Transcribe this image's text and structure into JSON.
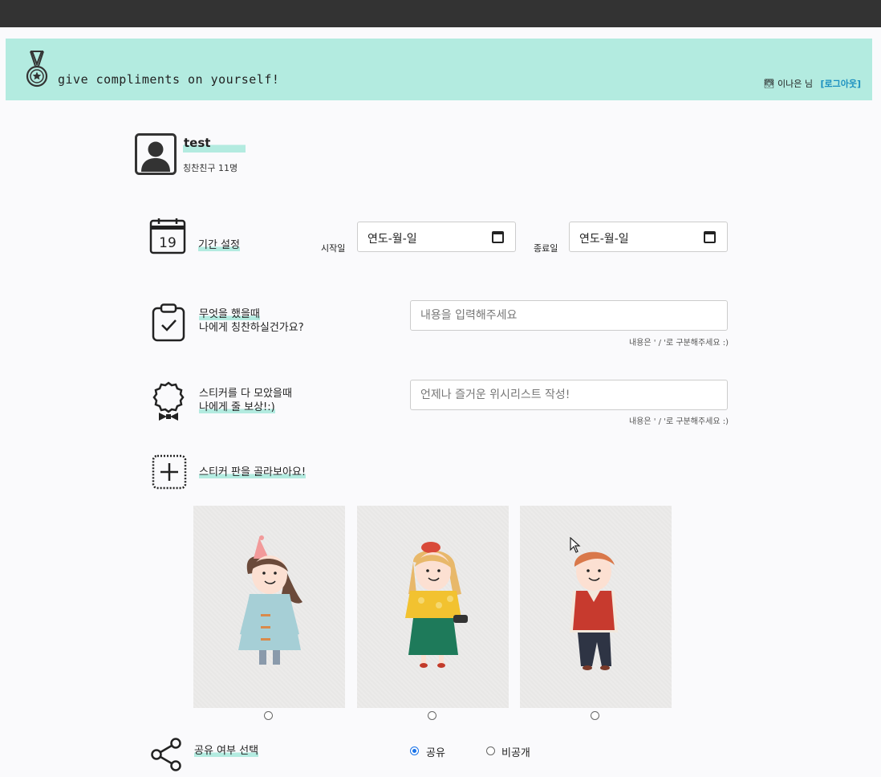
{
  "header": {
    "title": "give compliments on yourself!",
    "user_name": "이나은 님",
    "logout_label": "[로그아웃]",
    "user_icon": "sun-icon"
  },
  "profile": {
    "name": "test",
    "friends": "칭찬친구 11명"
  },
  "period": {
    "label": "기간 설정",
    "start_label": "시작일",
    "start_value": "연도-월-일",
    "end_label": "종료일",
    "end_value": "연도-월-일",
    "calendar_day": "19"
  },
  "task": {
    "line1": "무엇을 했을때",
    "line2": "나에게 칭찬하실건가요?",
    "placeholder": "내용을 입력해주세요",
    "hint": "내용은 ' / '로 구분해주세요 :)"
  },
  "reward": {
    "line1": "스티커를 다 모았을때",
    "line2": "나에게 줄 보상!:)",
    "placeholder": "언제나 즐거운 위시리스트 작성!",
    "hint": "내용은 ' / '로 구분해주세요 :)"
  },
  "sticker_board": {
    "label": "스티커 판을 골라보아요!",
    "options": [
      {
        "name": "girl-blue-coat",
        "selected": false
      },
      {
        "name": "girl-yellow-top",
        "selected": false
      },
      {
        "name": "boy-red-vest",
        "selected": false
      }
    ]
  },
  "share": {
    "label": "공유 여부 선택",
    "public_label": "공유",
    "private_label": "비공개",
    "selected": "public"
  },
  "colors": {
    "accent": "#b3ebe0",
    "link": "#1a8fc0",
    "radio": "#1a73e8"
  }
}
